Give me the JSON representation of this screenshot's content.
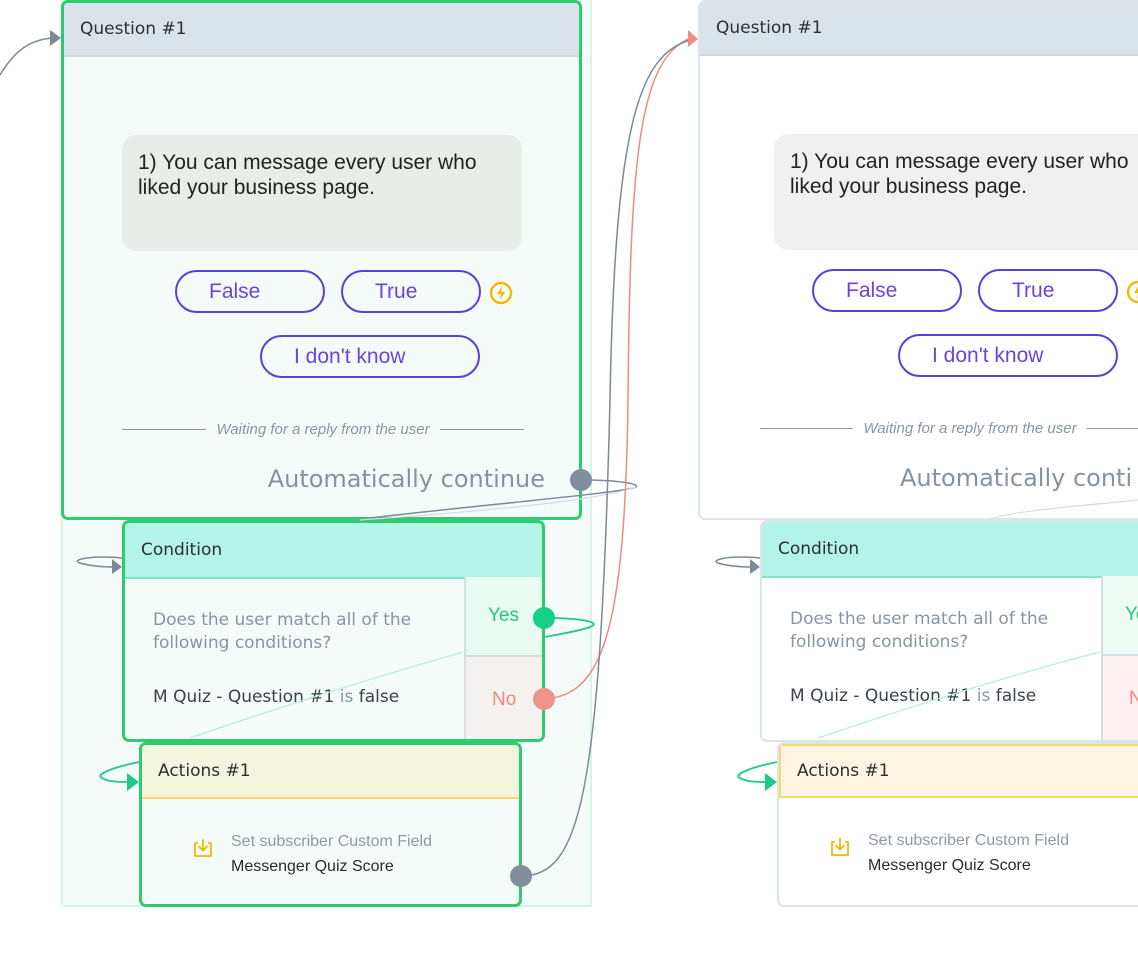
{
  "flow": {
    "left_column": {
      "question": {
        "title": "Question #1",
        "message": "1) You can message every user who liked your business page.",
        "buttons": [
          "False",
          "True",
          "I don't know"
        ],
        "waiting_text": "Waiting for a reply from the user",
        "auto_continue": "Automatically continue",
        "selected": true
      },
      "condition": {
        "title": "Condition",
        "question": "Does the user match all of the following conditions?",
        "rule": {
          "field": "M Quiz - Question #1",
          "operator": "is",
          "value": "false"
        },
        "yes_label": "Yes",
        "no_label": "No"
      },
      "actions": {
        "title": "Actions #1",
        "action_type": "Set subscriber Custom Field",
        "action_value": "Messenger Quiz Score"
      }
    },
    "right_column": {
      "question": {
        "title": "Question #1",
        "message": "1) You can message every user who liked your business page.",
        "buttons": [
          "False",
          "True",
          "I don't know"
        ],
        "waiting_text": "Waiting for a reply from the user",
        "auto_continue": "Automatically conti"
      },
      "condition": {
        "title": "Condition",
        "question": "Does the user match all of the following conditions?",
        "rule": {
          "field": "M Quiz - Question #1",
          "operator": "is",
          "value": "false"
        },
        "yes_label": "Ye",
        "no_label": "N"
      },
      "actions": {
        "title": "Actions #1",
        "action_type": "Set subscriber Custom Field",
        "action_value": "Messenger Quiz Score"
      }
    }
  },
  "colors": {
    "selected_border": "#2ecc71",
    "button_purple": "#5b3fd6",
    "bolt_yellow": "#f5b800",
    "yes_green": "#26c77d",
    "no_red": "#ee8a82",
    "wire_gray": "#7a8a99",
    "wire_red": "#f08a84",
    "wire_green": "#1ec989"
  },
  "icons": {
    "bolt": "lightning-bolt-icon",
    "custom_field": "download-tray-icon"
  }
}
